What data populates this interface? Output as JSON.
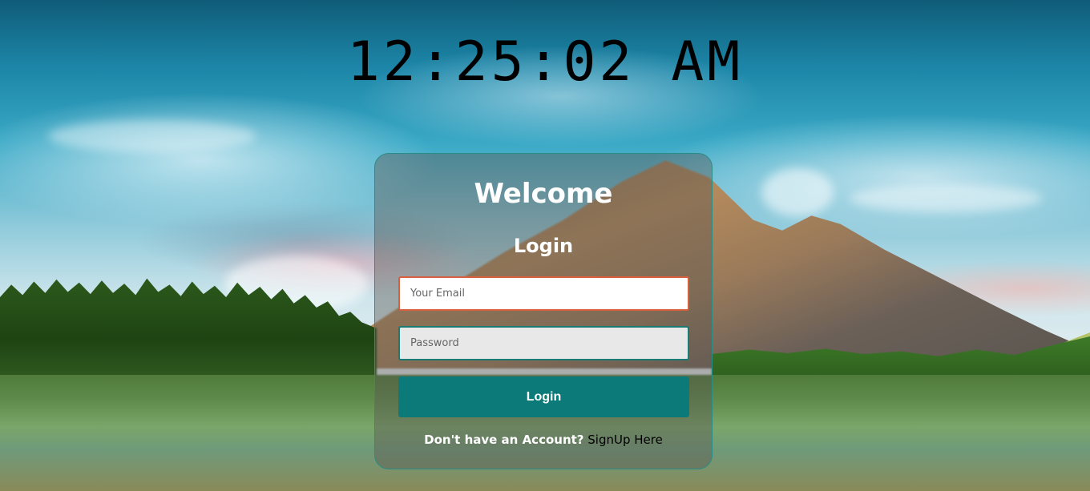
{
  "clock": {
    "time": "12:25:02 AM"
  },
  "login_card": {
    "title": "Welcome",
    "heading": "Login",
    "email_placeholder": "Your Email",
    "password_placeholder": "Password",
    "login_button": "Login",
    "signup_prompt": "Don't have an Account?",
    "signup_link": "SignUp Here"
  },
  "colors": {
    "accent": "#0c7a78",
    "email_border": "#d9603e",
    "card_border": "#2a8c86"
  }
}
